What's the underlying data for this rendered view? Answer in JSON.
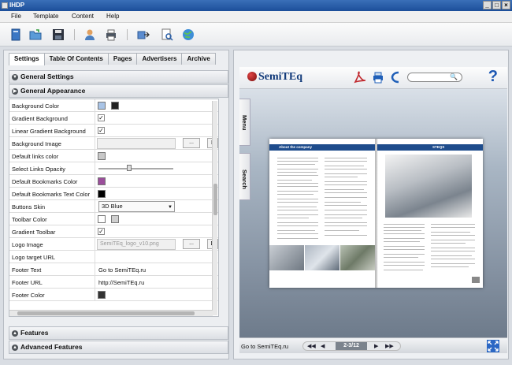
{
  "window": {
    "title": "IHDP"
  },
  "menu": {
    "items": [
      "File",
      "Template",
      "Content",
      "Help"
    ]
  },
  "tabs": [
    "Settings",
    "Table Of Contents",
    "Pages",
    "Advertisers",
    "Archive"
  ],
  "sections": {
    "general_settings": "General Settings",
    "general_appearance": "General Appearance",
    "features": "Features",
    "advanced_features": "Advanced Features"
  },
  "properties": [
    {
      "label": "Background Color"
    },
    {
      "label": "Gradient Background"
    },
    {
      "label": "Linear Gradient Background"
    },
    {
      "label": "Background Image",
      "button": "...",
      "extra": "D"
    },
    {
      "label": "Default links color"
    },
    {
      "label": "Select Links Opacity"
    },
    {
      "label": "Default Bookmarks Color"
    },
    {
      "label": "Default Bookmarks Text Color"
    },
    {
      "label": "Buttons Skin",
      "value": "3D Blue"
    },
    {
      "label": "Toolbar Color"
    },
    {
      "label": "Gradient Toolbar"
    },
    {
      "label": "Logo Image",
      "value": "SemiTEq_logo_v10.png",
      "button": "...",
      "extra": "D"
    },
    {
      "label": "Logo target URL",
      "value": ""
    },
    {
      "label": "Footer Text",
      "value": "Go to SemiTEq.ru"
    },
    {
      "label": "Footer URL",
      "value": "http://SemiTEq.ru"
    },
    {
      "label": "Footer Color"
    }
  ],
  "colors": {
    "background_color": "#a9c4e6",
    "background_color_2": "#222222",
    "default_links_color": "#c8c8c8",
    "bookmarks_color": "#9b4e9b",
    "bookmarks_text_color": "#000000",
    "toolbar_color_1": "#ffffff",
    "toolbar_color_2": "#cfcfcf",
    "footer_color": "#333333",
    "accent": "#1e4c8c"
  },
  "checks": {
    "gradient_background": true,
    "linear_gradient_background": true,
    "gradient_toolbar": true
  },
  "viewer": {
    "logo": "SemiTEq",
    "side_tabs": [
      "Menu",
      "Search"
    ],
    "left_page_header": "About the company",
    "right_page_header": "STEQS",
    "footer_text": "Go to SemiTEq.ru",
    "page_indicator": "2-3/12",
    "help_glyph": "?"
  },
  "icons": [
    "new-icon",
    "open-icon",
    "save-icon",
    "user-icon",
    "print-icon",
    "export-icon",
    "preview-icon",
    "web-icon"
  ]
}
